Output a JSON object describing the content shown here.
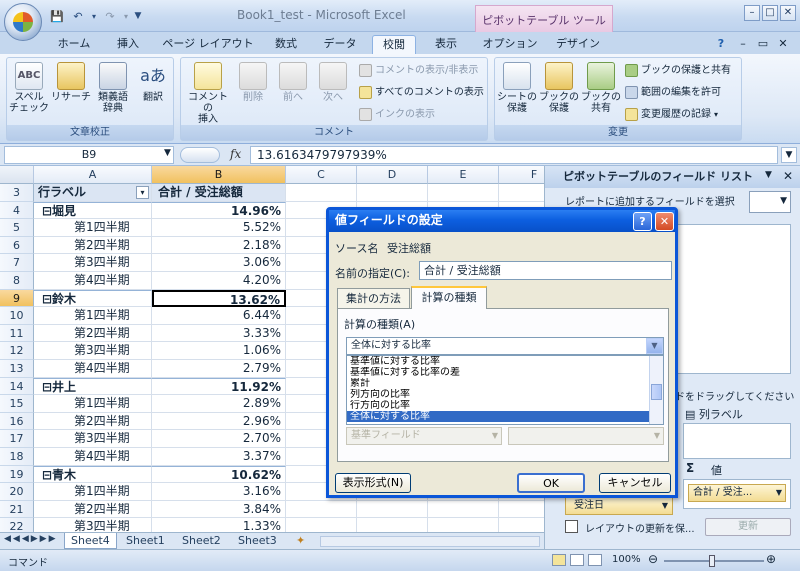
{
  "window": {
    "title": "Book1_test - Microsoft Excel",
    "context_tab": "ピボットテーブル ツール"
  },
  "ribbon_tabs": [
    "ホーム",
    "挿入",
    "ページ レイアウト",
    "数式",
    "データ",
    "校閲",
    "表示",
    "オプション",
    "デザイン"
  ],
  "ribbon": {
    "proofing": {
      "title": "文章校正",
      "spell": "スペル\nチェック",
      "research": "リサーチ",
      "thesaurus": "類義語\n辞典",
      "translate": "翻訳"
    },
    "comments": {
      "title": "コメント",
      "new": "コメントの\n挿入",
      "delete": "削除",
      "prev": "前へ",
      "next": "次へ",
      "show_hide": "コメントの表示/非表示",
      "show_all": "すべてのコメントの表示",
      "show_ink": "インクの表示"
    },
    "changes": {
      "title": "変更",
      "protect_sheet": "シートの\n保護",
      "protect_book": "ブックの\n保護",
      "share_book": "ブックの\n共有",
      "protect_share": "ブックの保護と共有",
      "allow_ranges": "範囲の編集を許可",
      "track_changes": "変更履歴の記録"
    }
  },
  "formula_bar": {
    "name_box": "B9",
    "fx": "fx",
    "value": "13.6163479797939%"
  },
  "columns": [
    "A",
    "B",
    "C",
    "D",
    "E",
    "F"
  ],
  "pivot_header": {
    "row_num": "3",
    "a": "行ラベル",
    "b": "合計 / 受注総額"
  },
  "rows": [
    {
      "num": "4",
      "a": "⊟堀見",
      "b": "14.96%",
      "bold": true
    },
    {
      "num": "5",
      "a": "第1四半期",
      "b": "5.52%"
    },
    {
      "num": "6",
      "a": "第2四半期",
      "b": "2.18%"
    },
    {
      "num": "7",
      "a": "第3四半期",
      "b": "3.06%"
    },
    {
      "num": "8",
      "a": "第4四半期",
      "b": "4.20%"
    },
    {
      "num": "9",
      "a": "⊟鈴木",
      "b": "13.62%",
      "bold": true,
      "selected": true
    },
    {
      "num": "10",
      "a": "第1四半期",
      "b": "6.44%"
    },
    {
      "num": "11",
      "a": "第2四半期",
      "b": "3.33%"
    },
    {
      "num": "12",
      "a": "第3四半期",
      "b": "1.06%"
    },
    {
      "num": "13",
      "a": "第4四半期",
      "b": "2.79%"
    },
    {
      "num": "14",
      "a": "⊟井上",
      "b": "11.92%",
      "bold": true
    },
    {
      "num": "15",
      "a": "第1四半期",
      "b": "2.89%"
    },
    {
      "num": "16",
      "a": "第2四半期",
      "b": "2.96%"
    },
    {
      "num": "17",
      "a": "第3四半期",
      "b": "2.70%"
    },
    {
      "num": "18",
      "a": "第4四半期",
      "b": "3.37%"
    },
    {
      "num": "19",
      "a": "⊟青木",
      "b": "10.62%",
      "bold": true
    },
    {
      "num": "20",
      "a": "第1四半期",
      "b": "3.16%"
    },
    {
      "num": "21",
      "a": "第2四半期",
      "b": "3.84%"
    },
    {
      "num": "22",
      "a": "第3四半期",
      "b": "1.33%"
    }
  ],
  "sheet_tabs": [
    "Sheet4",
    "Sheet1",
    "Sheet2",
    "Sheet3"
  ],
  "status": {
    "mode": "コマンド",
    "zoom": "100%"
  },
  "field_list": {
    "title": "ピボットテーブルのフィールド リスト",
    "subtitle": "レポートに追加するフィールドを選択",
    "drag_hint": "ドをドラッグしてください",
    "col_label": "列ラベル",
    "values_label": "値",
    "sigma": "Σ",
    "row_field": "受注日",
    "value_field": "合計 / 受注...",
    "defer": "レイアウトの更新を保...",
    "update": "更新"
  },
  "dialog": {
    "title": "値フィールドの設定",
    "source_label": "ソース名",
    "source_value": "受注総額",
    "name_label": "名前の指定(C):",
    "name_value": "合計 / 受注総額",
    "tab1": "集計の方法",
    "tab2": "計算の種類",
    "calc_label": "計算の種類(A)",
    "calc_selected": "全体に対する比率",
    "calc_options": [
      "基準値に対する比率",
      "基準値に対する比率の差",
      "累計",
      "列方向の比率",
      "行方向の比率",
      "全体に対する比率"
    ],
    "base_label": "基準フィールド",
    "number_format": "表示形式(N)",
    "ok": "OK",
    "cancel": "キャンセル"
  },
  "colors": {
    "dialog_border": "#0b56d8",
    "selection": "#316ac5",
    "ribbon_bg": "#dde8f6"
  }
}
